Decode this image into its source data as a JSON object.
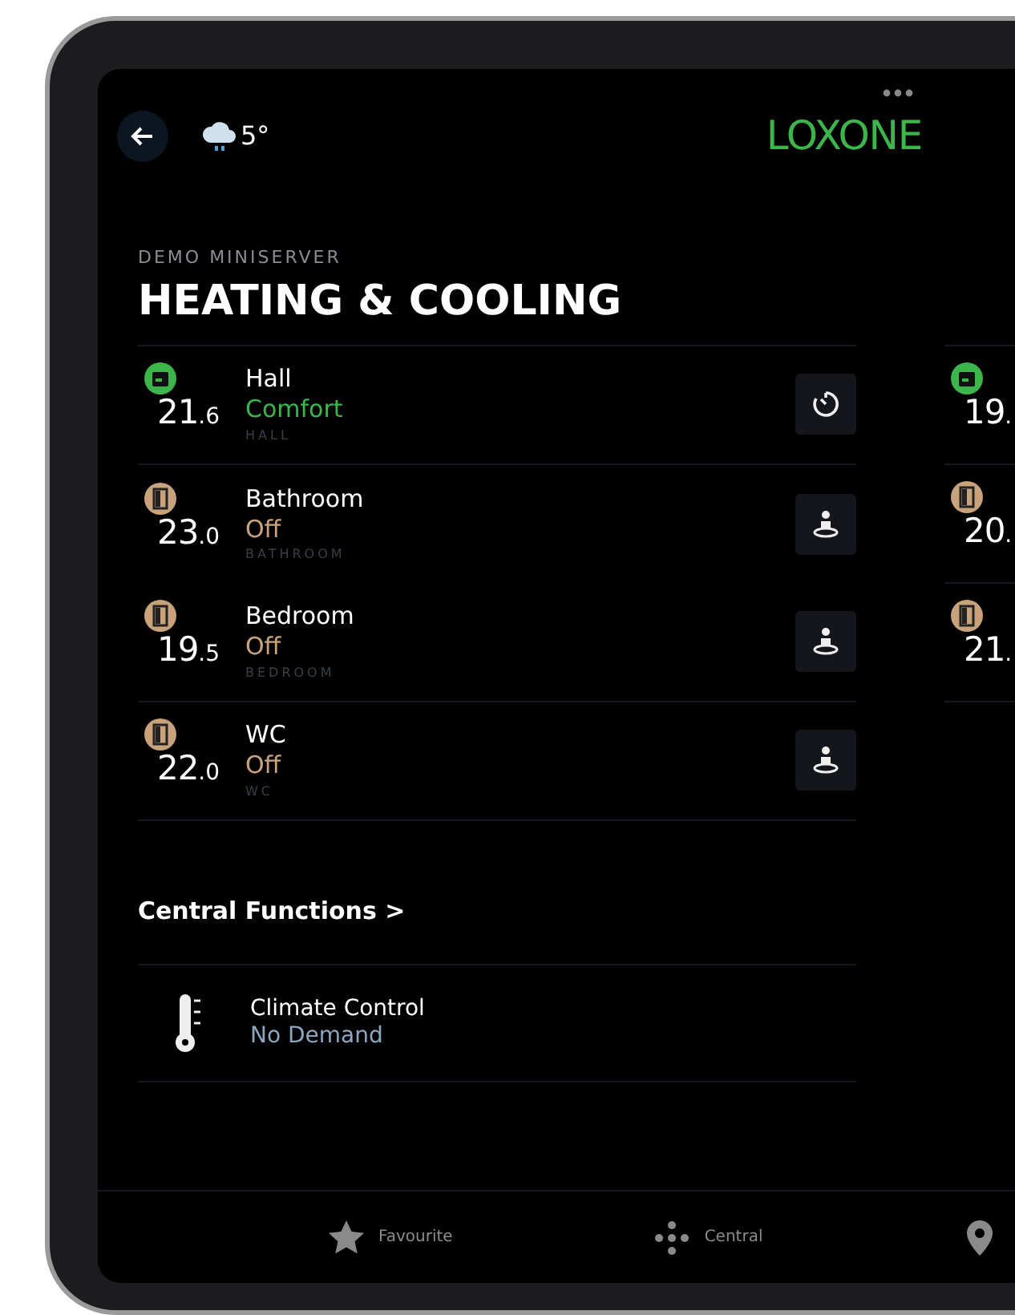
{
  "header": {
    "weather_temp": "5°",
    "logo": "LOXONE"
  },
  "page": {
    "subtitle": "DEMO MINISERVER",
    "title": "HEATING & COOLING"
  },
  "rooms_left": [
    {
      "name": "Hall",
      "temp": "21",
      "decimal": ".6",
      "status": "Comfort",
      "kind": "comfort",
      "room": "HALL"
    },
    {
      "name": "Bathroom",
      "temp": "23",
      "decimal": ".0",
      "status": "Off",
      "kind": "off",
      "room": "BATHROOM"
    },
    {
      "name": "Bedroom",
      "temp": "19",
      "decimal": ".5",
      "status": "Off",
      "kind": "off",
      "room": "BEDROOM"
    },
    {
      "name": "WC",
      "temp": "22",
      "decimal": ".0",
      "status": "Off",
      "kind": "off",
      "room": "WC"
    }
  ],
  "rooms_right": [
    {
      "temp": "19",
      "decimal": ".",
      "kind": "comfort"
    },
    {
      "temp": "20",
      "decimal": ".",
      "kind": "off"
    },
    {
      "temp": "21",
      "decimal": ".",
      "kind": "off"
    }
  ],
  "central": {
    "heading": "Central Functions >",
    "items": [
      {
        "name": "Climate Control",
        "status": "No Demand"
      }
    ]
  },
  "tabbar": [
    {
      "label": "Favourite"
    },
    {
      "label": "Central"
    }
  ]
}
